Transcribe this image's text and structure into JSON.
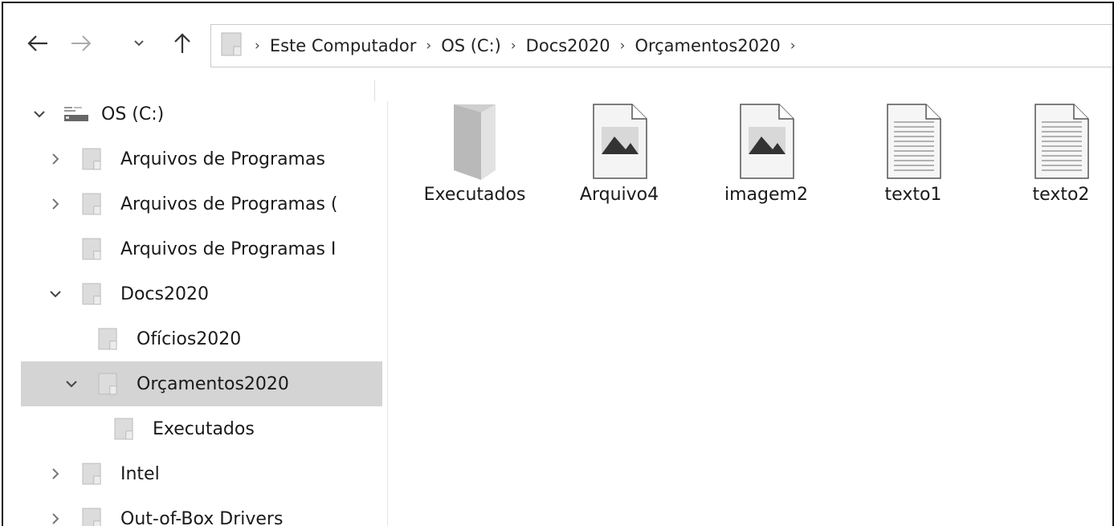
{
  "address_bar": {
    "breadcrumbs": [
      "Este Computador",
      "OS (C:)",
      "Docs2020",
      "Orçamentos2020"
    ],
    "separator": "›"
  },
  "nav": {
    "back_icon": "arrow-left-icon",
    "forward_icon": "arrow-right-icon",
    "recent_icon": "chevron-down-icon",
    "up_icon": "arrow-up-icon"
  },
  "sidebar": {
    "items": [
      {
        "label": "OS (C:)",
        "state": "expanded",
        "icon": "drive-icon"
      },
      {
        "label": "Arquivos de Programas",
        "state": "collapsed",
        "icon": "folder-icon"
      },
      {
        "label": "Arquivos de Programas (",
        "state": "collapsed",
        "icon": "folder-icon"
      },
      {
        "label": "Arquivos de Programas I",
        "state": "none",
        "icon": "folder-icon"
      },
      {
        "label": "Docs2020",
        "state": "expanded",
        "icon": "folder-icon"
      },
      {
        "label": "Ofícios2020",
        "state": "none",
        "icon": "folder-icon"
      },
      {
        "label": "Orçamentos2020",
        "state": "expanded",
        "icon": "folder-icon",
        "selected": true
      },
      {
        "label": "Executados",
        "state": "none",
        "icon": "folder-icon"
      },
      {
        "label": "Intel",
        "state": "collapsed",
        "icon": "folder-icon"
      },
      {
        "label": "Out-of-Box Drivers",
        "state": "collapsed",
        "icon": "folder-icon"
      }
    ]
  },
  "files": [
    {
      "label": "Executados",
      "icon": "folder-icon"
    },
    {
      "label": "Arquivo4",
      "icon": "image-file-icon"
    },
    {
      "label": "imagem2",
      "icon": "image-file-icon"
    },
    {
      "label": "texto1",
      "icon": "text-file-icon"
    },
    {
      "label": "texto2",
      "icon": "text-file-icon"
    }
  ],
  "colors": {
    "selection": "#d4d4d4",
    "folder_fill": "#dcdcdc",
    "border": "#111111"
  }
}
